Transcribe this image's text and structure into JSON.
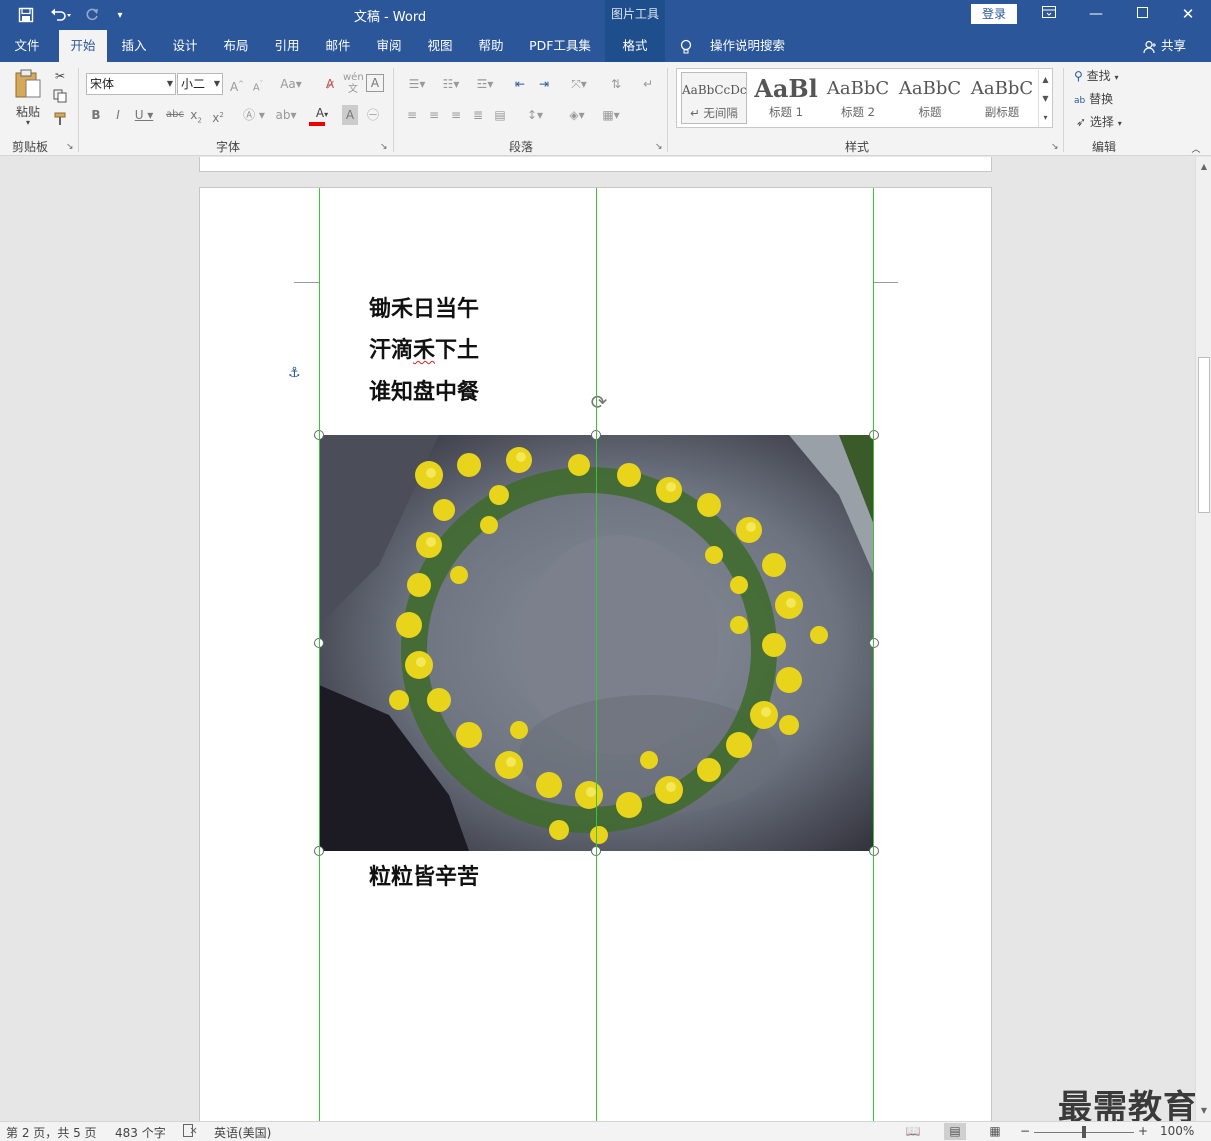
{
  "app": {
    "title": "文稿 - Word",
    "context_tab_group": "图片工具",
    "login_label": "登录",
    "share_label": "共享"
  },
  "window_icons": {
    "save": "save-icon",
    "undo": "undo-icon",
    "redo": "redo-icon",
    "customize": "customize-qat-icon",
    "ribbon_display": "ribbon-display-icon",
    "minimize": "minimize-icon",
    "maximize": "maximize-icon",
    "close": "close-icon"
  },
  "tabs": [
    "文件",
    "开始",
    "插入",
    "设计",
    "布局",
    "引用",
    "邮件",
    "审阅",
    "视图",
    "帮助",
    "PDF工具集",
    "格式"
  ],
  "active_tab": "开始",
  "tell_me": "操作说明搜索",
  "ribbon": {
    "clipboard": {
      "label": "剪贴板",
      "paste": "粘贴"
    },
    "font": {
      "label": "字体",
      "font_name": "宋体",
      "font_size": "小二"
    },
    "paragraph": {
      "label": "段落"
    },
    "styles": {
      "label": "样式",
      "items": [
        {
          "preview": "AaBbCcDc",
          "name": "↵ 无间隔"
        },
        {
          "preview": "AaBl",
          "name": "标题 1"
        },
        {
          "preview": "AaBbC",
          "name": "标题 2"
        },
        {
          "preview": "AaBbC",
          "name": "标题"
        },
        {
          "preview": "AaBbC",
          "name": "副标题"
        }
      ]
    },
    "editing": {
      "label": "编辑",
      "find": "查找",
      "replace": "替换",
      "select": "选择"
    }
  },
  "document": {
    "poem": [
      "锄禾日当午",
      "汗滴禾下土",
      "谁知盘中餐",
      "粒粒皆辛苦"
    ],
    "image_description": "yellow flower wreath on rock"
  },
  "status": {
    "page": "第 2 页，共 5 页",
    "words": "483 个字",
    "language": "英语(美国)",
    "zoom": "100%"
  },
  "watermark": "最需教育"
}
